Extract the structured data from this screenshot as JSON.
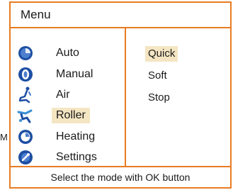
{
  "outside_text": "M",
  "menu": {
    "title": "Menu",
    "hint": "Select the mode with OK button",
    "items": [
      {
        "label": "Auto",
        "icon": "auto-mode-icon",
        "selected": false
      },
      {
        "label": "Manual",
        "icon": "manual-mode-icon",
        "selected": false
      },
      {
        "label": "Air",
        "icon": "air-mode-icon",
        "selected": false
      },
      {
        "label": "Roller",
        "icon": "roller-mode-icon",
        "selected": true
      },
      {
        "label": "Heating",
        "icon": "heating-mode-icon",
        "selected": false
      },
      {
        "label": "Settings",
        "icon": "settings-icon",
        "selected": false
      }
    ],
    "submenu": [
      {
        "label": "Quick",
        "selected": true
      },
      {
        "label": "Soft",
        "selected": false
      },
      {
        "label": "Stop",
        "selected": false
      }
    ]
  },
  "colors": {
    "border": "#e87b22",
    "highlight": "#f4e6c2",
    "icon_blue": "#1d4fa3"
  }
}
